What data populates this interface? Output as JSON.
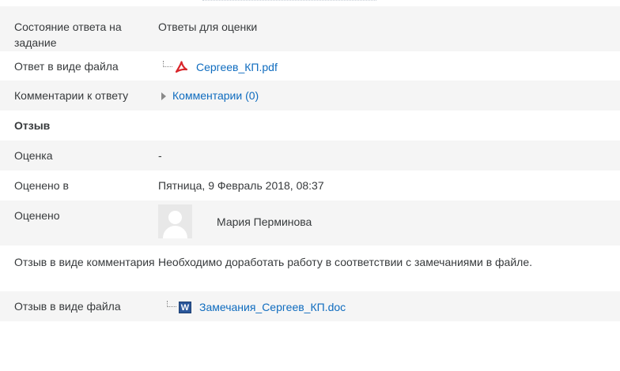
{
  "rows": [
    {
      "label": "Состояние ответа на задание",
      "value": "Ответы для оценки"
    },
    {
      "label": "Ответ в виде файла",
      "file_name": "Сергеев_КП.pdf",
      "file_icon": "pdf-icon"
    },
    {
      "label": "Комментарии к ответу",
      "link": "Комментарии (0)"
    },
    {
      "heading": "Отзыв"
    },
    {
      "label": "Оценка",
      "value": "-"
    },
    {
      "label": "Оценено в",
      "value": "Пятница, 9 Февраль 2018, 08:37"
    },
    {
      "label": "Оценено",
      "user_name": "Мария Перминова",
      "avatar": "user-avatar-placeholder"
    },
    {
      "label": "Отзыв в виде комментария",
      "value": "Необходимо доработать работу в соответствии с замечаниями в файле."
    },
    {
      "label": "Отзыв в виде файла",
      "file_name": "Замечания_Сергеев_КП.doc",
      "file_icon": "word-doc-icon"
    }
  ],
  "colors": {
    "link": "#0f6cbf",
    "row_stripe": "#f5f5f5",
    "text": "#373a3c",
    "pdf_red": "#d9262b",
    "word_blue": "#2b579a"
  }
}
